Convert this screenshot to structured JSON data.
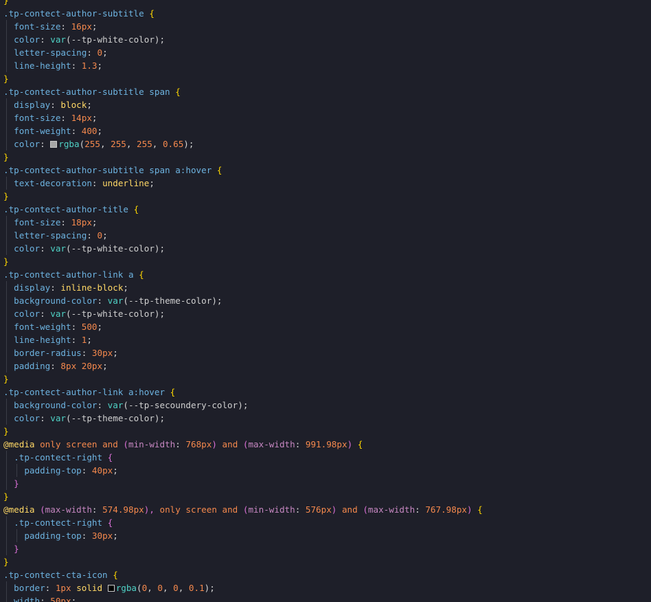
{
  "editor": {
    "lines": [
      [
        {
          "t": "}",
          "c": "c-brace1"
        }
      ],
      [
        {
          "t": ".tp-contect-author-subtitle ",
          "c": "c-selector"
        },
        {
          "t": "{",
          "c": "c-brace1"
        }
      ],
      [
        {
          "t": "  font-size",
          "c": "c-prop"
        },
        {
          "t": ": ",
          "c": "c-punct"
        },
        {
          "t": "16px",
          "c": "c-number"
        },
        {
          "t": ";",
          "c": "c-punct"
        }
      ],
      [
        {
          "t": "  color",
          "c": "c-prop"
        },
        {
          "t": ": ",
          "c": "c-punct"
        },
        {
          "t": "var",
          "c": "c-func"
        },
        {
          "t": "(",
          "c": "c-punct"
        },
        {
          "t": "--tp-white-color",
          "c": "c-var"
        },
        {
          "t": ");",
          "c": "c-punct"
        }
      ],
      [
        {
          "t": "  letter-spacing",
          "c": "c-prop"
        },
        {
          "t": ": ",
          "c": "c-punct"
        },
        {
          "t": "0",
          "c": "c-number"
        },
        {
          "t": ";",
          "c": "c-punct"
        }
      ],
      [
        {
          "t": "  line-height",
          "c": "c-prop"
        },
        {
          "t": ": ",
          "c": "c-punct"
        },
        {
          "t": "1.3",
          "c": "c-number"
        },
        {
          "t": ";",
          "c": "c-punct"
        }
      ],
      [
        {
          "t": "}",
          "c": "c-brace1"
        }
      ],
      [
        {
          "t": ".tp-contect-author-subtitle span ",
          "c": "c-selector"
        },
        {
          "t": "{",
          "c": "c-brace1"
        }
      ],
      [
        {
          "t": "  display",
          "c": "c-prop"
        },
        {
          "t": ": ",
          "c": "c-punct"
        },
        {
          "t": "block",
          "c": "c-value"
        },
        {
          "t": ";",
          "c": "c-punct"
        }
      ],
      [
        {
          "t": "  font-size",
          "c": "c-prop"
        },
        {
          "t": ": ",
          "c": "c-punct"
        },
        {
          "t": "14px",
          "c": "c-number"
        },
        {
          "t": ";",
          "c": "c-punct"
        }
      ],
      [
        {
          "t": "  font-weight",
          "c": "c-prop"
        },
        {
          "t": ": ",
          "c": "c-punct"
        },
        {
          "t": "400",
          "c": "c-number"
        },
        {
          "t": ";",
          "c": "c-punct"
        }
      ],
      [
        {
          "t": "  color",
          "c": "c-prop"
        },
        {
          "t": ": ",
          "c": "c-punct"
        },
        {
          "swatch": "#a6a6a6"
        },
        {
          "t": "rgba",
          "c": "c-func"
        },
        {
          "t": "(",
          "c": "c-punct"
        },
        {
          "t": "255",
          "c": "c-number"
        },
        {
          "t": ", ",
          "c": "c-punct"
        },
        {
          "t": "255",
          "c": "c-number"
        },
        {
          "t": ", ",
          "c": "c-punct"
        },
        {
          "t": "255",
          "c": "c-number"
        },
        {
          "t": ", ",
          "c": "c-punct"
        },
        {
          "t": "0.65",
          "c": "c-number"
        },
        {
          "t": ");",
          "c": "c-punct"
        }
      ],
      [
        {
          "t": "}",
          "c": "c-brace1"
        }
      ],
      [
        {
          "t": ".tp-contect-author-subtitle span a:hover ",
          "c": "c-selector"
        },
        {
          "t": "{",
          "c": "c-brace1"
        }
      ],
      [
        {
          "t": "  text-decoration",
          "c": "c-prop"
        },
        {
          "t": ": ",
          "c": "c-punct"
        },
        {
          "t": "underline",
          "c": "c-value"
        },
        {
          "t": ";",
          "c": "c-punct"
        }
      ],
      [
        {
          "t": "}",
          "c": "c-brace1"
        }
      ],
      [
        {
          "t": ".tp-contect-author-title ",
          "c": "c-selector"
        },
        {
          "t": "{",
          "c": "c-brace1"
        }
      ],
      [
        {
          "t": "  font-size",
          "c": "c-prop"
        },
        {
          "t": ": ",
          "c": "c-punct"
        },
        {
          "t": "18px",
          "c": "c-number"
        },
        {
          "t": ";",
          "c": "c-punct"
        }
      ],
      [
        {
          "t": "  letter-spacing",
          "c": "c-prop"
        },
        {
          "t": ": ",
          "c": "c-punct"
        },
        {
          "t": "0",
          "c": "c-number"
        },
        {
          "t": ";",
          "c": "c-punct"
        }
      ],
      [
        {
          "t": "  color",
          "c": "c-prop"
        },
        {
          "t": ": ",
          "c": "c-punct"
        },
        {
          "t": "var",
          "c": "c-func"
        },
        {
          "t": "(",
          "c": "c-punct"
        },
        {
          "t": "--tp-white-color",
          "c": "c-var"
        },
        {
          "t": ");",
          "c": "c-punct"
        }
      ],
      [
        {
          "t": "}",
          "c": "c-brace1"
        }
      ],
      [
        {
          "t": ".tp-contect-author-link a ",
          "c": "c-selector"
        },
        {
          "t": "{",
          "c": "c-brace1"
        }
      ],
      [
        {
          "t": "  display",
          "c": "c-prop"
        },
        {
          "t": ": ",
          "c": "c-punct"
        },
        {
          "t": "inline-block",
          "c": "c-value"
        },
        {
          "t": ";",
          "c": "c-punct"
        }
      ],
      [
        {
          "t": "  background-color",
          "c": "c-prop"
        },
        {
          "t": ": ",
          "c": "c-punct"
        },
        {
          "t": "var",
          "c": "c-func"
        },
        {
          "t": "(",
          "c": "c-punct"
        },
        {
          "t": "--tp-theme-color",
          "c": "c-var"
        },
        {
          "t": ");",
          "c": "c-punct"
        }
      ],
      [
        {
          "t": "  color",
          "c": "c-prop"
        },
        {
          "t": ": ",
          "c": "c-punct"
        },
        {
          "t": "var",
          "c": "c-func"
        },
        {
          "t": "(",
          "c": "c-punct"
        },
        {
          "t": "--tp-white-color",
          "c": "c-var"
        },
        {
          "t": ");",
          "c": "c-punct"
        }
      ],
      [
        {
          "t": "  font-weight",
          "c": "c-prop"
        },
        {
          "t": ": ",
          "c": "c-punct"
        },
        {
          "t": "500",
          "c": "c-number"
        },
        {
          "t": ";",
          "c": "c-punct"
        }
      ],
      [
        {
          "t": "  line-height",
          "c": "c-prop"
        },
        {
          "t": ": ",
          "c": "c-punct"
        },
        {
          "t": "1",
          "c": "c-number"
        },
        {
          "t": ";",
          "c": "c-punct"
        }
      ],
      [
        {
          "t": "  border-radius",
          "c": "c-prop"
        },
        {
          "t": ": ",
          "c": "c-punct"
        },
        {
          "t": "30px",
          "c": "c-number"
        },
        {
          "t": ";",
          "c": "c-punct"
        }
      ],
      [
        {
          "t": "  padding",
          "c": "c-prop"
        },
        {
          "t": ": ",
          "c": "c-punct"
        },
        {
          "t": "8px 20px",
          "c": "c-number"
        },
        {
          "t": ";",
          "c": "c-punct"
        }
      ],
      [
        {
          "t": "}",
          "c": "c-brace1"
        }
      ],
      [
        {
          "t": ".tp-contect-author-link a:hover ",
          "c": "c-selector"
        },
        {
          "t": "{",
          "c": "c-brace1"
        }
      ],
      [
        {
          "t": "  background-color",
          "c": "c-prop"
        },
        {
          "t": ": ",
          "c": "c-punct"
        },
        {
          "t": "var",
          "c": "c-func"
        },
        {
          "t": "(",
          "c": "c-punct"
        },
        {
          "t": "--tp-secoundery-color",
          "c": "c-var"
        },
        {
          "t": ");",
          "c": "c-punct"
        }
      ],
      [
        {
          "t": "  color",
          "c": "c-prop"
        },
        {
          "t": ": ",
          "c": "c-punct"
        },
        {
          "t": "var",
          "c": "c-func"
        },
        {
          "t": "(",
          "c": "c-punct"
        },
        {
          "t": "--tp-theme-color",
          "c": "c-var"
        },
        {
          "t": ");",
          "c": "c-punct"
        }
      ],
      [
        {
          "t": "}",
          "c": "c-brace1"
        }
      ],
      [
        {
          "t": "@media ",
          "c": "c-at"
        },
        {
          "t": "only screen ",
          "c": "c-keyword"
        },
        {
          "t": "and ",
          "c": "c-keyword"
        },
        {
          "t": "(",
          "c": "c-paren1"
        },
        {
          "t": "min-width",
          "c": "c-mediaprop"
        },
        {
          "t": ": ",
          "c": "c-punct"
        },
        {
          "t": "768px",
          "c": "c-number"
        },
        {
          "t": ") ",
          "c": "c-paren1"
        },
        {
          "t": "and ",
          "c": "c-keyword"
        },
        {
          "t": "(",
          "c": "c-paren1"
        },
        {
          "t": "max-width",
          "c": "c-mediaprop"
        },
        {
          "t": ": ",
          "c": "c-punct"
        },
        {
          "t": "991.98px",
          "c": "c-number"
        },
        {
          "t": ") ",
          "c": "c-paren1"
        },
        {
          "t": "{",
          "c": "c-brace1"
        }
      ],
      [
        {
          "t": "  .tp-contect-right ",
          "c": "c-selector"
        },
        {
          "t": "{",
          "c": "c-brace2"
        }
      ],
      [
        {
          "t": "    padding-top",
          "c": "c-prop"
        },
        {
          "t": ": ",
          "c": "c-punct"
        },
        {
          "t": "40px",
          "c": "c-number"
        },
        {
          "t": ";",
          "c": "c-punct"
        }
      ],
      [
        {
          "t": "  }",
          "c": "c-brace2"
        }
      ],
      [
        {
          "t": "}",
          "c": "c-brace1"
        }
      ],
      [
        {
          "t": "@media ",
          "c": "c-at"
        },
        {
          "t": "(",
          "c": "c-paren1"
        },
        {
          "t": "max-width",
          "c": "c-mediaprop"
        },
        {
          "t": ": ",
          "c": "c-punct"
        },
        {
          "t": "574.98px",
          "c": "c-number"
        },
        {
          "t": "), ",
          "c": "c-paren1"
        },
        {
          "t": "only screen ",
          "c": "c-keyword"
        },
        {
          "t": "and ",
          "c": "c-keyword"
        },
        {
          "t": "(",
          "c": "c-paren1"
        },
        {
          "t": "min-width",
          "c": "c-mediaprop"
        },
        {
          "t": ": ",
          "c": "c-punct"
        },
        {
          "t": "576px",
          "c": "c-number"
        },
        {
          "t": ") ",
          "c": "c-paren1"
        },
        {
          "t": "and ",
          "c": "c-keyword"
        },
        {
          "t": "(",
          "c": "c-paren1"
        },
        {
          "t": "max-width",
          "c": "c-mediaprop"
        },
        {
          "t": ": ",
          "c": "c-punct"
        },
        {
          "t": "767.98px",
          "c": "c-number"
        },
        {
          "t": ") ",
          "c": "c-paren1"
        },
        {
          "t": "{",
          "c": "c-brace1"
        }
      ],
      [
        {
          "t": "  .tp-contect-right ",
          "c": "c-selector"
        },
        {
          "t": "{",
          "c": "c-brace2"
        }
      ],
      [
        {
          "t": "    padding-top",
          "c": "c-prop"
        },
        {
          "t": ": ",
          "c": "c-punct"
        },
        {
          "t": "30px",
          "c": "c-number"
        },
        {
          "t": ";",
          "c": "c-punct"
        }
      ],
      [
        {
          "t": "  }",
          "c": "c-brace2"
        }
      ],
      [
        {
          "t": "}",
          "c": "c-brace1"
        }
      ],
      [
        {
          "t": ".tp-contect-cta-icon ",
          "c": "c-selector"
        },
        {
          "t": "{",
          "c": "c-brace1"
        }
      ],
      [
        {
          "t": "  border",
          "c": "c-prop"
        },
        {
          "t": ": ",
          "c": "c-punct"
        },
        {
          "t": "1px ",
          "c": "c-number"
        },
        {
          "t": "solid ",
          "c": "c-value"
        },
        {
          "swatch": "#000000"
        },
        {
          "t": "rgba",
          "c": "c-func"
        },
        {
          "t": "(",
          "c": "c-punct"
        },
        {
          "t": "0",
          "c": "c-number"
        },
        {
          "t": ", ",
          "c": "c-punct"
        },
        {
          "t": "0",
          "c": "c-number"
        },
        {
          "t": ", ",
          "c": "c-punct"
        },
        {
          "t": "0",
          "c": "c-number"
        },
        {
          "t": ", ",
          "c": "c-punct"
        },
        {
          "t": "0.1",
          "c": "c-number"
        },
        {
          "t": ");",
          "c": "c-punct"
        }
      ],
      [
        {
          "t": "  width",
          "c": "c-prop"
        },
        {
          "t": ": ",
          "c": "c-punct"
        },
        {
          "t": "50px",
          "c": "c-number"
        },
        {
          "t": ";",
          "c": "c-punct"
        }
      ]
    ],
    "current_line": 47,
    "colors": {
      "background": "#1e1f29",
      "selector": "#6db3e0",
      "brace": "#ffd700",
      "nested_brace": "#da70d6",
      "number": "#f5894d",
      "keyword_value": "#ffd866",
      "function": "#4fd1c5",
      "media_property": "#c586c0"
    }
  }
}
